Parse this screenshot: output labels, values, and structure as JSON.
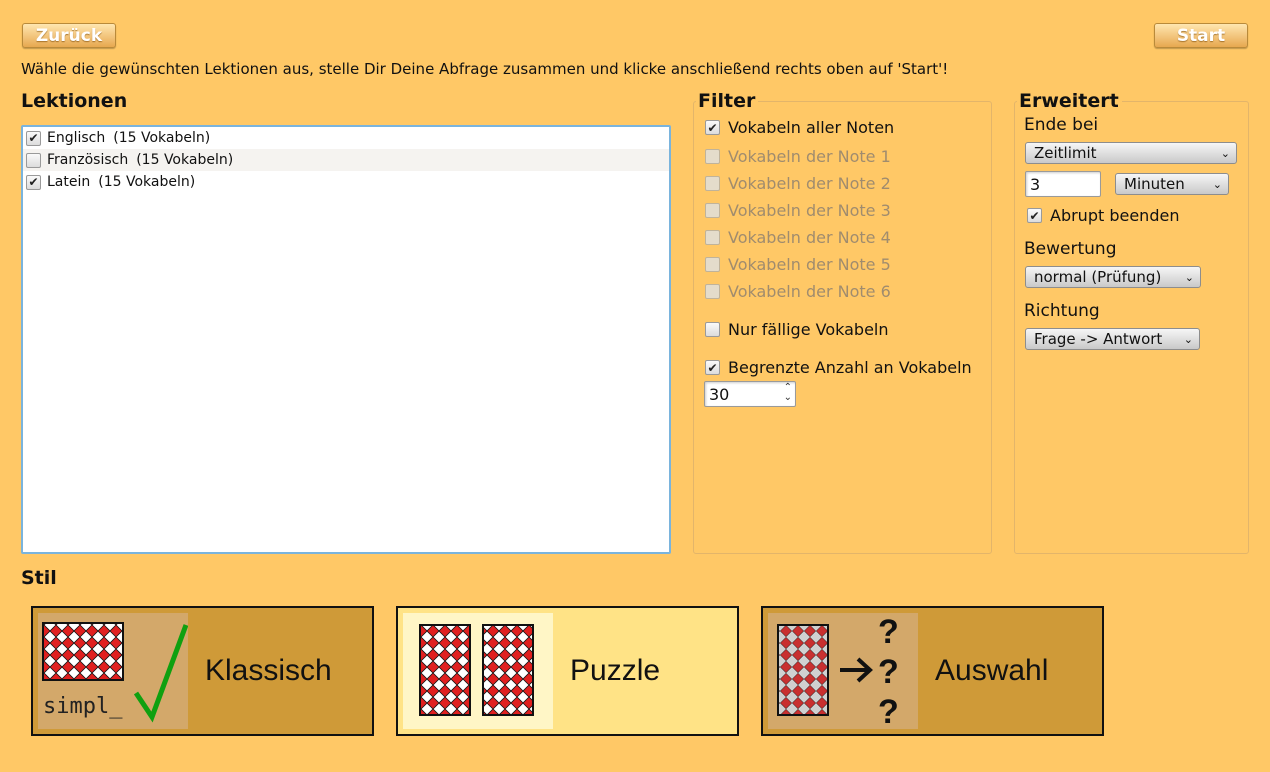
{
  "toolbar": {
    "back_label": "Zurück",
    "start_label": "Start"
  },
  "instruction": "Wähle die gewünschten Lektionen aus, stelle Dir Deine Abfrage zusammen und klicke anschließend rechts oben auf 'Start'!",
  "lessons": {
    "title": "Lektionen",
    "items": [
      {
        "name": "Englisch",
        "count": "(15 Vokabeln)",
        "checked": true
      },
      {
        "name": "Französisch",
        "count": "(15 Vokabeln)",
        "checked": false
      },
      {
        "name": "Latein",
        "count": "(15 Vokabeln)",
        "checked": true
      }
    ]
  },
  "filter": {
    "title": "Filter",
    "all_grades": {
      "label": "Vokabeln aller Noten",
      "checked": true
    },
    "grades": [
      "Vokabeln der Note 1",
      "Vokabeln der Note 2",
      "Vokabeln der Note 3",
      "Vokabeln der Note 4",
      "Vokabeln der Note 5",
      "Vokabeln der Note 6"
    ],
    "due_only": {
      "label": "Nur fällige Vokabeln",
      "checked": false
    },
    "limit": {
      "label": "Begrenzte Anzahl an Vokabeln",
      "checked": true,
      "value": "30"
    }
  },
  "extended": {
    "title": "Erweitert",
    "end_label": "Ende bei",
    "end_mode": "Zeitlimit",
    "time_value": "3",
    "time_unit": "Minuten",
    "abrupt": {
      "label": "Abrupt beenden",
      "checked": true
    },
    "rating_label": "Bewertung",
    "rating_value": "normal (Prüfung)",
    "direction_label": "Richtung",
    "direction_value": "Frage -> Antwort"
  },
  "style": {
    "title": "Stil",
    "options": [
      {
        "label": "Klassisch",
        "thumb_text": "simpl_"
      },
      {
        "label": "Puzzle"
      },
      {
        "label": "Auswahl",
        "thumb_marks": "???"
      }
    ]
  },
  "colors": {
    "background": "#ffc866",
    "card_red": "#e02020",
    "check_green": "#10a010"
  }
}
